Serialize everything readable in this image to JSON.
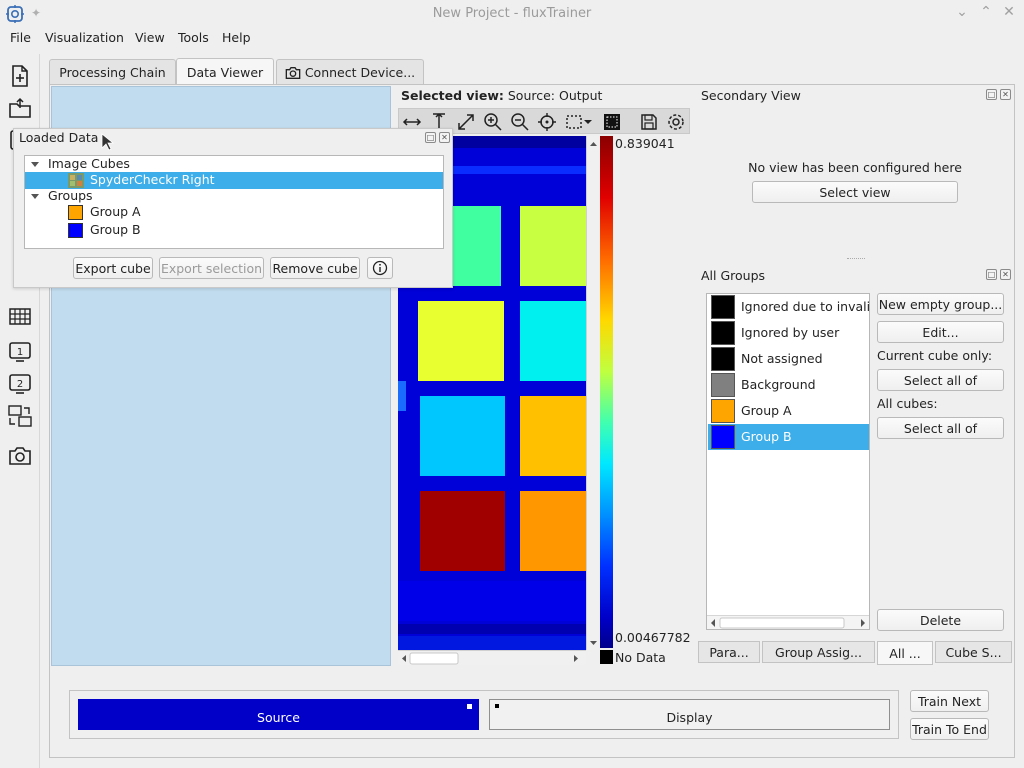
{
  "window": {
    "title": "New Project - fluxTrainer"
  },
  "menu": [
    "File",
    "Visualization",
    "View",
    "Tools",
    "Help"
  ],
  "tabs": {
    "processing_chain": "Processing Chain",
    "data_viewer": "Data Viewer",
    "connect_device": "Connect Device..."
  },
  "loaded_data": {
    "title": "Loaded Data",
    "tree": {
      "image_cubes_label": "Image Cubes",
      "cube_item": "SpyderCheckr Right",
      "groups_label": "Groups",
      "group_a": "Group A",
      "group_b": "Group B"
    },
    "buttons": {
      "export_cube": "Export cube",
      "export_selection": "Export selection",
      "remove_cube": "Remove cube"
    }
  },
  "viewer": {
    "selected_view_label": "Selected view:",
    "selected_view_value": "Source: Output",
    "colorbar_max": "0.839041",
    "colorbar_min": "0.00467782",
    "no_data": "No Data"
  },
  "secondary_view": {
    "title": "Secondary View",
    "message": "No view has been configured here",
    "select_view": "Select view"
  },
  "all_groups": {
    "title": "All Groups",
    "groups": [
      {
        "name": "Ignored due to invalid",
        "color": "#000000"
      },
      {
        "name": "Ignored by user",
        "color": "#000000"
      },
      {
        "name": "Not assigned",
        "color": "#000000"
      },
      {
        "name": "Background",
        "color": "#808080"
      },
      {
        "name": "Group A",
        "color": "#ffa500"
      },
      {
        "name": "Group B",
        "color": "#0000ff"
      }
    ],
    "new_empty_group": "New empty group...",
    "edit": "Edit...",
    "current_cube_only": "Current cube only:",
    "select_all_of_1": "Select all of",
    "all_cubes": "All cubes:",
    "select_all_of_2": "Select all of",
    "delete": "Delete"
  },
  "bottom_tabs": [
    "Para...",
    "Group Assig...",
    "All ...",
    "Cube S..."
  ],
  "flow": {
    "source": "Source",
    "display": "Display",
    "train_next": "Train Next",
    "train_to_end": "Train To End"
  },
  "colors": {
    "accent": "#3daee9",
    "source_block": "#0000c8",
    "image_background": "#0000d8"
  }
}
